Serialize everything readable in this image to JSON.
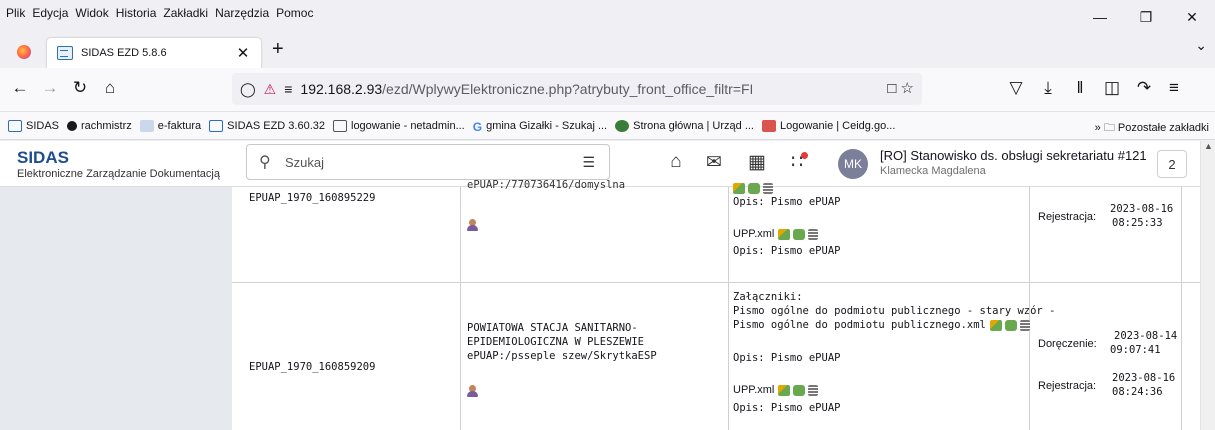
{
  "browser": {
    "menu": [
      "Plik",
      "Edycja",
      "Widok",
      "Historia",
      "Zakładki",
      "Narzędzia",
      "Pomoc"
    ],
    "menu_underline": [
      "P",
      "E",
      "W",
      "H",
      "Z",
      "N",
      "c"
    ],
    "tab_title": "SIDAS EZD 5.8.6",
    "url_host": "192.168.2.93",
    "url_path": "/ezd/WplywyElektroniczne.php?atrybuty_front_office_filtr=FRM_PRZYJETY_PRZEZ_",
    "bookmarks": [
      {
        "label": "SIDAS",
        "icon": "sidas-icon",
        "color": "#2a6fb7"
      },
      {
        "label": "rachmistrz",
        "icon": "rachmistrz-icon",
        "color": "#1a1a1a"
      },
      {
        "label": "e-faktura",
        "icon": "e-faktura-icon",
        "color": "#7aa0c8"
      },
      {
        "label": "SIDAS EZD 3.60.32",
        "icon": "sidas-icon",
        "color": "#2a6fb7"
      },
      {
        "label": "logowanie - netadmin...",
        "icon": "netadmin-icon",
        "color": "#555555"
      },
      {
        "label": "gmina Gizałki - Szukaj ...",
        "icon": "google-icon",
        "color": "#4285f4"
      },
      {
        "label": "Strona główna | Urząd ...",
        "icon": "urzad-icon",
        "color": "#3a7d3a"
      },
      {
        "label": "Logowanie | Ceidg.go...",
        "icon": "ceidg-icon",
        "color": "#d9534f"
      }
    ],
    "other_bookmarks": "Pozostałe zakładki"
  },
  "app": {
    "brand": "SIDAS",
    "brand_sub": "Elektroniczne Zarządzanie Dokumentacją",
    "search_placeholder": "Szukaj",
    "avatar_initials": "MK",
    "user_role": "[RO] Stanowisko ds. obsługi sekretariatu #121",
    "user_name": "Klamecka Magdalena",
    "count": "2"
  },
  "rows": [
    {
      "id": "EPUAP_1970_160895229",
      "sender_cut": "ePUAP:/770736416/domyslna",
      "att_top": "Opis: Pismo ePUAP",
      "upp": "UPP.xml",
      "upp_opis": "Opis: Pismo ePUAP",
      "dates": [
        {
          "label": "Rejestracja:",
          "date": "2023-08-16",
          "time": "08:25:33"
        }
      ]
    },
    {
      "id": "EPUAP_1970_160859209",
      "sender_lines": [
        "POWIATOWA STACJA SANITARNO-",
        "EPIDEMIOLOGICZNA W PLESZEWIE",
        "ePUAP:/psseple szew/SkrytkaESP"
      ],
      "att_header": "Załączniki:",
      "att_lines": [
        "Pismo ogólne do podmiotu publicznego - stary wzór -",
        "Pismo ogólne do podmiotu publicznego.xml"
      ],
      "att_opis": "Opis: Pismo ePUAP",
      "upp": "UPP.xml",
      "upp_opis": "Opis: Pismo ePUAP",
      "dates": [
        {
          "label": "Doręczenie:",
          "date": "2023-08-14",
          "time": "09:07:41"
        },
        {
          "label": "Rejestracja:",
          "date": "2023-08-16",
          "time": "08:24:36"
        }
      ]
    }
  ]
}
